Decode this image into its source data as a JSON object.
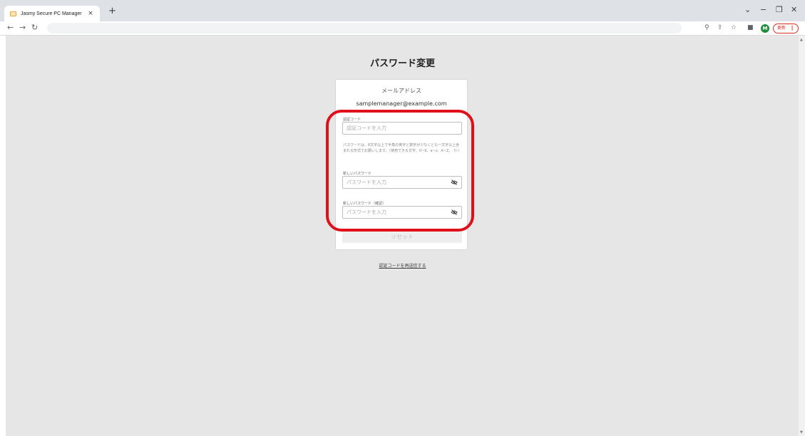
{
  "browser": {
    "tab_title": "Jasmy Secure PC Manager",
    "tab_close": "×",
    "new_tab": "+",
    "profile_initial": "M",
    "update_label": "更新",
    "update_menu": "⋮",
    "window_controls": {
      "dropdown": "⌄",
      "minimize": "−",
      "maximize": "❐",
      "close": "✕"
    }
  },
  "page": {
    "title": "パスワード変更",
    "email_label": "メールアドレス",
    "email_value": "samplemanager@example.com",
    "code_label": "認証コード",
    "code_placeholder": "認証コードを入力",
    "hint": "パスワードは、8文字以上で半角の英字と数字が少なくとも一文字以上含まれる形式でお願いします。（使用できる文字、0~9、a~z、A~Z、.?/-）",
    "new_password_label": "新しいパスワード",
    "new_password_placeholder": "パスワードを入力",
    "confirm_password_label": "新しいパスワード（確認）",
    "confirm_password_placeholder": "パスワードを入力",
    "reset_button": "リセット",
    "resend_link": "認証コードを再送信する"
  },
  "colors": {
    "highlight": "#e0101a",
    "background": "#e6e6e6",
    "profile": "#1e8e3e"
  },
  "icons": [
    "back-icon",
    "forward-icon",
    "reload-icon",
    "zoom-icon",
    "share-icon",
    "star-icon",
    "sidepanel-icon",
    "eye-off-icon"
  ]
}
